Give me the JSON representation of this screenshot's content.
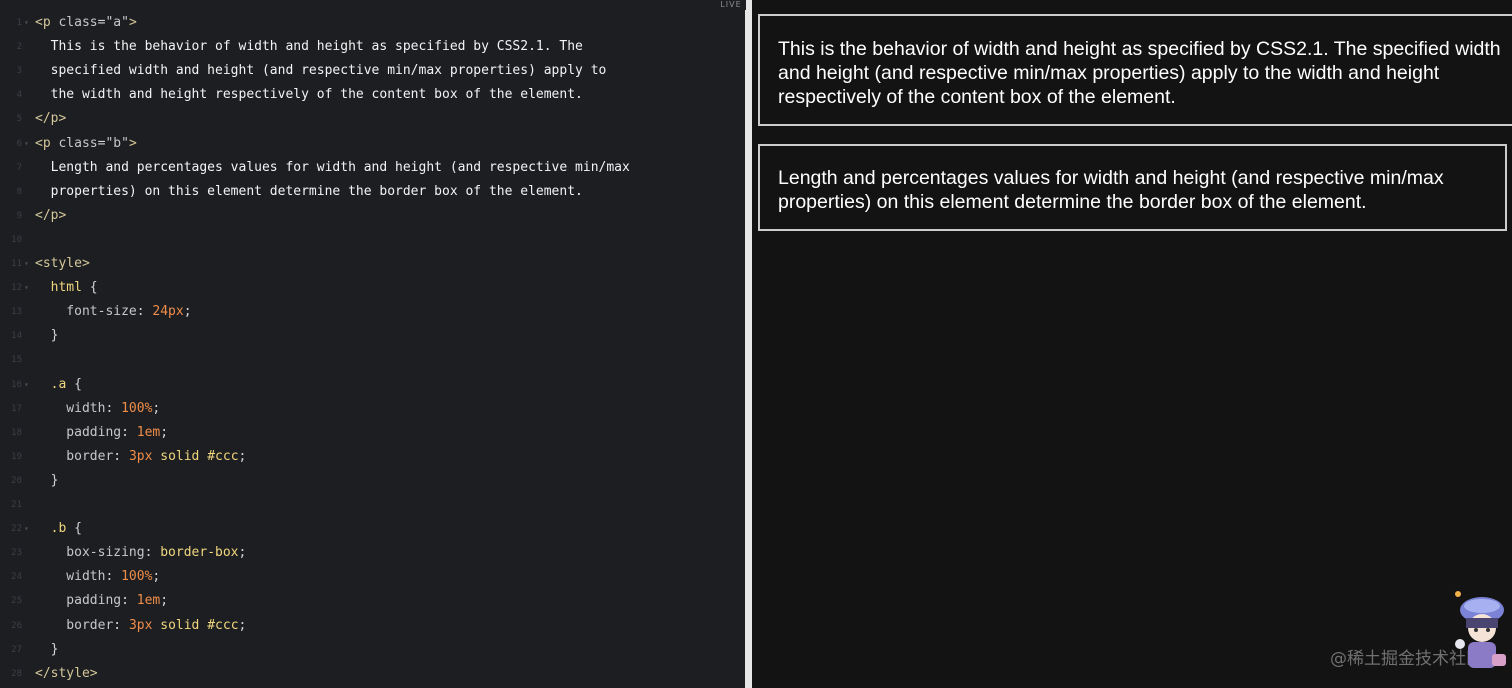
{
  "live_label": "LIVE",
  "watermark": "@稀土掘金技术社区",
  "preview": {
    "paragraph_a": "This is the behavior of width and height as specified by CSS2.1. The specified width and height (and respective min/max properties) apply to the width and height respectively of the content box of the element.",
    "paragraph_b": "Length and percentages values for width and height (and respective min/max properties) on this element determine the border box of the element."
  },
  "code_lines": [
    {
      "n": "1",
      "fold": true,
      "tokens": [
        [
          "t-tag",
          "<p "
        ],
        [
          "t-attr",
          "class"
        ],
        [
          "t-punc",
          "="
        ],
        [
          "t-str",
          "\"a\""
        ],
        [
          "t-tag",
          ">"
        ]
      ]
    },
    {
      "n": "2",
      "fold": false,
      "tokens": [
        [
          "t-plain",
          "  This is the behavior of width and height as specified by CSS2.1. The"
        ]
      ]
    },
    {
      "n": "3",
      "fold": false,
      "tokens": [
        [
          "t-plain",
          "  specified width and height (and respective min/max properties) apply to"
        ]
      ]
    },
    {
      "n": "4",
      "fold": false,
      "tokens": [
        [
          "t-plain",
          "  the width and height respectively of the content box of the element."
        ]
      ]
    },
    {
      "n": "5",
      "fold": false,
      "tokens": [
        [
          "t-tag",
          "</p>"
        ]
      ]
    },
    {
      "n": "6",
      "fold": true,
      "tokens": [
        [
          "t-tag",
          "<p "
        ],
        [
          "t-attr",
          "class"
        ],
        [
          "t-punc",
          "="
        ],
        [
          "t-str",
          "\"b\""
        ],
        [
          "t-tag",
          ">"
        ]
      ]
    },
    {
      "n": "7",
      "fold": false,
      "tokens": [
        [
          "t-plain",
          "  Length and percentages values for width and height (and respective min/max"
        ]
      ]
    },
    {
      "n": "8",
      "fold": false,
      "tokens": [
        [
          "t-plain",
          "  properties) on this element determine the border box of the element."
        ]
      ]
    },
    {
      "n": "9",
      "fold": false,
      "tokens": [
        [
          "t-tag",
          "</p>"
        ]
      ]
    },
    {
      "n": "10",
      "fold": false,
      "tokens": []
    },
    {
      "n": "11",
      "fold": true,
      "tokens": [
        [
          "t-tag",
          "<style>"
        ]
      ]
    },
    {
      "n": "12",
      "fold": true,
      "tokens": [
        [
          "t-sel",
          "  html"
        ],
        [
          "t-punc",
          " {"
        ]
      ]
    },
    {
      "n": "13",
      "fold": false,
      "tokens": [
        [
          "t-prop",
          "    font-size"
        ],
        [
          "t-punc",
          ": "
        ],
        [
          "t-num",
          "24px"
        ],
        [
          "t-punc",
          ";"
        ]
      ]
    },
    {
      "n": "14",
      "fold": false,
      "tokens": [
        [
          "t-punc",
          "  }"
        ]
      ]
    },
    {
      "n": "15",
      "fold": false,
      "tokens": []
    },
    {
      "n": "16",
      "fold": true,
      "tokens": [
        [
          "t-sel",
          "  .a"
        ],
        [
          "t-punc",
          " {"
        ]
      ]
    },
    {
      "n": "17",
      "fold": false,
      "tokens": [
        [
          "t-prop",
          "    width"
        ],
        [
          "t-punc",
          ": "
        ],
        [
          "t-num",
          "100%"
        ],
        [
          "t-punc",
          ";"
        ]
      ]
    },
    {
      "n": "18",
      "fold": false,
      "tokens": [
        [
          "t-prop",
          "    padding"
        ],
        [
          "t-punc",
          ": "
        ],
        [
          "t-num",
          "1em"
        ],
        [
          "t-punc",
          ";"
        ]
      ]
    },
    {
      "n": "19",
      "fold": false,
      "tokens": [
        [
          "t-prop",
          "    border"
        ],
        [
          "t-punc",
          ": "
        ],
        [
          "t-num",
          "3px"
        ],
        [
          "t-val",
          " solid"
        ],
        [
          "t-val",
          " #ccc"
        ],
        [
          "t-punc",
          ";"
        ]
      ]
    },
    {
      "n": "20",
      "fold": false,
      "tokens": [
        [
          "t-punc",
          "  }"
        ]
      ]
    },
    {
      "n": "21",
      "fold": false,
      "tokens": []
    },
    {
      "n": "22",
      "fold": true,
      "tokens": [
        [
          "t-sel",
          "  .b"
        ],
        [
          "t-punc",
          " {"
        ]
      ]
    },
    {
      "n": "23",
      "fold": false,
      "tokens": [
        [
          "t-prop",
          "    box-sizing"
        ],
        [
          "t-punc",
          ": "
        ],
        [
          "t-val",
          "border-box"
        ],
        [
          "t-punc",
          ";"
        ]
      ]
    },
    {
      "n": "24",
      "fold": false,
      "tokens": [
        [
          "t-prop",
          "    width"
        ],
        [
          "t-punc",
          ": "
        ],
        [
          "t-num",
          "100%"
        ],
        [
          "t-punc",
          ";"
        ]
      ]
    },
    {
      "n": "25",
      "fold": false,
      "tokens": [
        [
          "t-prop",
          "    padding"
        ],
        [
          "t-punc",
          ": "
        ],
        [
          "t-num",
          "1em"
        ],
        [
          "t-punc",
          ";"
        ]
      ]
    },
    {
      "n": "26",
      "fold": false,
      "tokens": [
        [
          "t-prop",
          "    border"
        ],
        [
          "t-punc",
          ": "
        ],
        [
          "t-num",
          "3px"
        ],
        [
          "t-val",
          " solid"
        ],
        [
          "t-val",
          " #ccc"
        ],
        [
          "t-punc",
          ";"
        ]
      ]
    },
    {
      "n": "27",
      "fold": false,
      "tokens": [
        [
          "t-punc",
          "  }"
        ]
      ]
    },
    {
      "n": "28",
      "fold": false,
      "tokens": [
        [
          "t-tag",
          "</style>"
        ]
      ]
    }
  ]
}
